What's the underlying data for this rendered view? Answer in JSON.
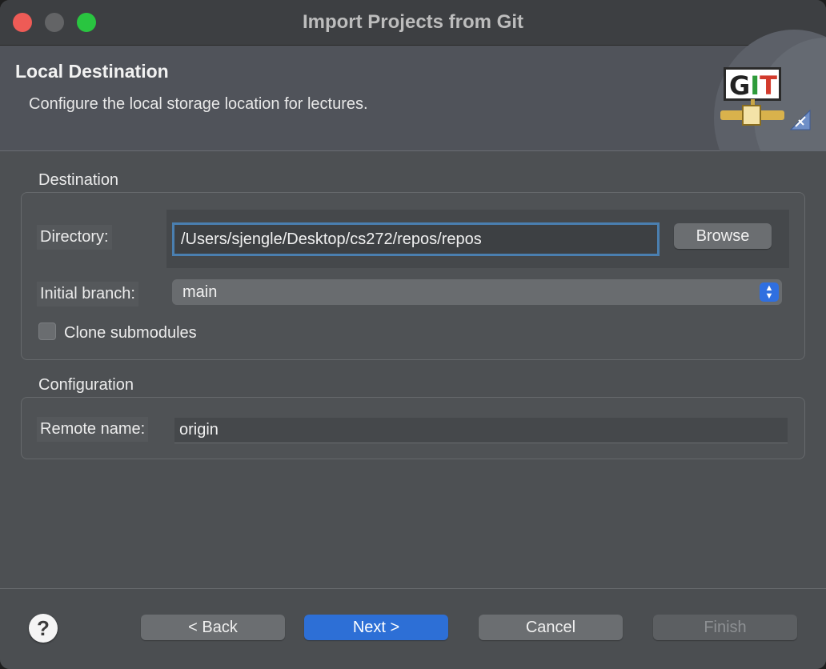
{
  "window": {
    "title": "Import Projects from Git"
  },
  "banner": {
    "title": "Local Destination",
    "description": "Configure the local storage location for lectures.",
    "logo_text": "GIT",
    "logo_icon": "git-repository-import-icon"
  },
  "destination": {
    "group_label": "Destination",
    "directory_label": "Directory:",
    "directory_value": "/Users/sjengle/Desktop/cs272/repos/repos",
    "browse_label": "Browse",
    "branch_label": "Initial branch:",
    "branch_value": "main",
    "clone_submodules_label": "Clone submodules",
    "clone_submodules_checked": false
  },
  "configuration": {
    "group_label": "Configuration",
    "remote_label": "Remote name:",
    "remote_value": "origin"
  },
  "footer": {
    "help_label": "?",
    "back_label": "< Back",
    "next_label": "Next >",
    "cancel_label": "Cancel",
    "finish_label": "Finish"
  },
  "colors": {
    "accent": "#2d6fd6",
    "close": "#ee5b56",
    "maximize": "#29c540",
    "focus_border": "#4a7fb0"
  }
}
